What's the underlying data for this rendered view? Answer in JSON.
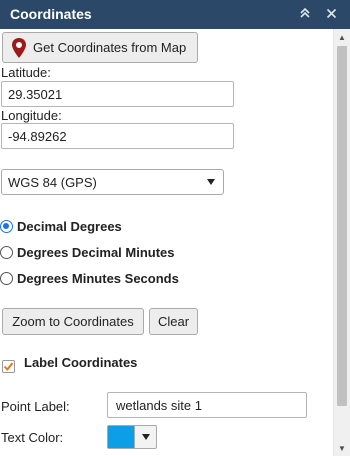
{
  "panel": {
    "title": "Coordinates",
    "collapse_icon": "double-chevron-up-icon",
    "close_icon": "close-icon"
  },
  "get_button": {
    "label": "Get Coordinates from Map",
    "icon": "map-marker-icon"
  },
  "latitude": {
    "label": "Latitude:",
    "value": "29.35021"
  },
  "longitude": {
    "label": "Longitude:",
    "value": "-94.89262"
  },
  "datum": {
    "selected": "WGS 84 (GPS)"
  },
  "format_options": [
    {
      "label": "Decimal Degrees",
      "checked": true
    },
    {
      "label": "Degrees Decimal Minutes",
      "checked": false
    },
    {
      "label": "Degrees Minutes Seconds",
      "checked": false
    }
  ],
  "actions": {
    "zoom_label": "Zoom to Coordinates",
    "clear_label": "Clear"
  },
  "label_coordinates": {
    "label": "Label Coordinates",
    "checked": true
  },
  "point_label": {
    "label": "Point Label:",
    "value": "wetlands site 1"
  },
  "text_color": {
    "label": "Text Color:",
    "value": "#0d9fe6"
  },
  "colors": {
    "header_bg": "#2b4868",
    "marker": "#9b1b1b",
    "check": "#e07a1f",
    "radio_accent": "#1a73e8"
  }
}
